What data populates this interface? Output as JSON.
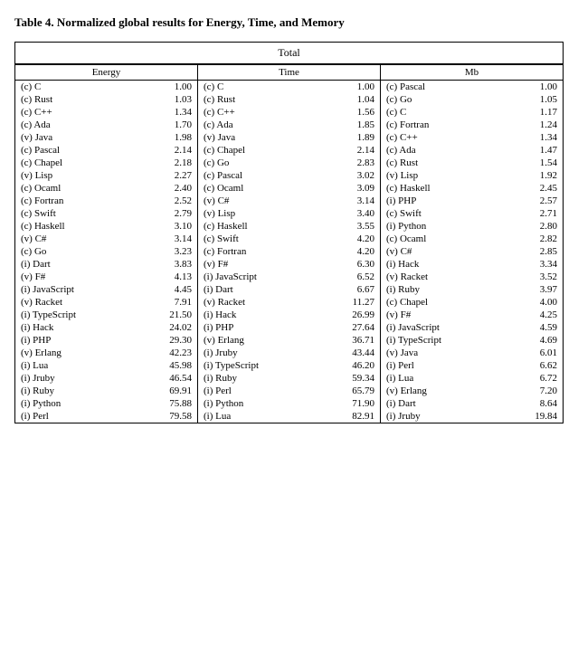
{
  "title": {
    "bold_part": "Table 4.",
    "rest": " Normalized global results for Energy, Time, and Memory"
  },
  "total_label": "Total",
  "columns": [
    {
      "header": "Energy",
      "rows": [
        {
          "lang": "(c) C",
          "val": "1.00"
        },
        {
          "lang": "(c) Rust",
          "val": "1.03"
        },
        {
          "lang": "(c) C++",
          "val": "1.34"
        },
        {
          "lang": "(c) Ada",
          "val": "1.70"
        },
        {
          "lang": "(v) Java",
          "val": "1.98"
        },
        {
          "lang": "(c) Pascal",
          "val": "2.14"
        },
        {
          "lang": "(c) Chapel",
          "val": "2.18"
        },
        {
          "lang": "(v) Lisp",
          "val": "2.27"
        },
        {
          "lang": "(c) Ocaml",
          "val": "2.40"
        },
        {
          "lang": "(c) Fortran",
          "val": "2.52"
        },
        {
          "lang": "(c) Swift",
          "val": "2.79"
        },
        {
          "lang": "(c) Haskell",
          "val": "3.10"
        },
        {
          "lang": "(v) C#",
          "val": "3.14"
        },
        {
          "lang": "(c) Go",
          "val": "3.23"
        },
        {
          "lang": "(i) Dart",
          "val": "3.83"
        },
        {
          "lang": "(v) F#",
          "val": "4.13"
        },
        {
          "lang": "(i) JavaScript",
          "val": "4.45"
        },
        {
          "lang": "(v) Racket",
          "val": "7.91"
        },
        {
          "lang": "(i) TypeScript",
          "val": "21.50"
        },
        {
          "lang": "(i) Hack",
          "val": "24.02"
        },
        {
          "lang": "(i) PHP",
          "val": "29.30"
        },
        {
          "lang": "(v) Erlang",
          "val": "42.23"
        },
        {
          "lang": "(i) Lua",
          "val": "45.98"
        },
        {
          "lang": "(i) Jruby",
          "val": "46.54"
        },
        {
          "lang": "(i) Ruby",
          "val": "69.91"
        },
        {
          "lang": "(i) Python",
          "val": "75.88"
        },
        {
          "lang": "(i) Perl",
          "val": "79.58"
        }
      ]
    },
    {
      "header": "Time",
      "rows": [
        {
          "lang": "(c) C",
          "val": "1.00"
        },
        {
          "lang": "(c) Rust",
          "val": "1.04"
        },
        {
          "lang": "(c) C++",
          "val": "1.56"
        },
        {
          "lang": "(c) Ada",
          "val": "1.85"
        },
        {
          "lang": "(v) Java",
          "val": "1.89"
        },
        {
          "lang": "(c) Chapel",
          "val": "2.14"
        },
        {
          "lang": "(c) Go",
          "val": "2.83"
        },
        {
          "lang": "(c) Pascal",
          "val": "3.02"
        },
        {
          "lang": "(c) Ocaml",
          "val": "3.09"
        },
        {
          "lang": "(v) C#",
          "val": "3.14"
        },
        {
          "lang": "(v) Lisp",
          "val": "3.40"
        },
        {
          "lang": "(c) Haskell",
          "val": "3.55"
        },
        {
          "lang": "(c) Swift",
          "val": "4.20"
        },
        {
          "lang": "(c) Fortran",
          "val": "4.20"
        },
        {
          "lang": "(v) F#",
          "val": "6.30"
        },
        {
          "lang": "(i) JavaScript",
          "val": "6.52"
        },
        {
          "lang": "(i) Dart",
          "val": "6.67"
        },
        {
          "lang": "(v) Racket",
          "val": "11.27"
        },
        {
          "lang": "(i) Hack",
          "val": "26.99"
        },
        {
          "lang": "(i) PHP",
          "val": "27.64"
        },
        {
          "lang": "(v) Erlang",
          "val": "36.71"
        },
        {
          "lang": "(i) Jruby",
          "val": "43.44"
        },
        {
          "lang": "(i) TypeScript",
          "val": "46.20"
        },
        {
          "lang": "(i) Ruby",
          "val": "59.34"
        },
        {
          "lang": "(i) Perl",
          "val": "65.79"
        },
        {
          "lang": "(i) Python",
          "val": "71.90"
        },
        {
          "lang": "(i) Lua",
          "val": "82.91"
        }
      ]
    },
    {
      "header": "Mb",
      "rows": [
        {
          "lang": "(c) Pascal",
          "val": "1.00"
        },
        {
          "lang": "(c) Go",
          "val": "1.05"
        },
        {
          "lang": "(c) C",
          "val": "1.17"
        },
        {
          "lang": "(c) Fortran",
          "val": "1.24"
        },
        {
          "lang": "(c) C++",
          "val": "1.34"
        },
        {
          "lang": "(c) Ada",
          "val": "1.47"
        },
        {
          "lang": "(c) Rust",
          "val": "1.54"
        },
        {
          "lang": "(v) Lisp",
          "val": "1.92"
        },
        {
          "lang": "(c) Haskell",
          "val": "2.45"
        },
        {
          "lang": "(i) PHP",
          "val": "2.57"
        },
        {
          "lang": "(c) Swift",
          "val": "2.71"
        },
        {
          "lang": "(i) Python",
          "val": "2.80"
        },
        {
          "lang": "(c) Ocaml",
          "val": "2.82"
        },
        {
          "lang": "(v) C#",
          "val": "2.85"
        },
        {
          "lang": "(i) Hack",
          "val": "3.34"
        },
        {
          "lang": "(v) Racket",
          "val": "3.52"
        },
        {
          "lang": "(i) Ruby",
          "val": "3.97"
        },
        {
          "lang": "(c) Chapel",
          "val": "4.00"
        },
        {
          "lang": "(v) F#",
          "val": "4.25"
        },
        {
          "lang": "(i) JavaScript",
          "val": "4.59"
        },
        {
          "lang": "(i) TypeScript",
          "val": "4.69"
        },
        {
          "lang": "(v) Java",
          "val": "6.01"
        },
        {
          "lang": "(i) Perl",
          "val": "6.62"
        },
        {
          "lang": "(i) Lua",
          "val": "6.72"
        },
        {
          "lang": "(v) Erlang",
          "val": "7.20"
        },
        {
          "lang": "(i) Dart",
          "val": "8.64"
        },
        {
          "lang": "(i) Jruby",
          "val": "19.84"
        }
      ]
    }
  ]
}
